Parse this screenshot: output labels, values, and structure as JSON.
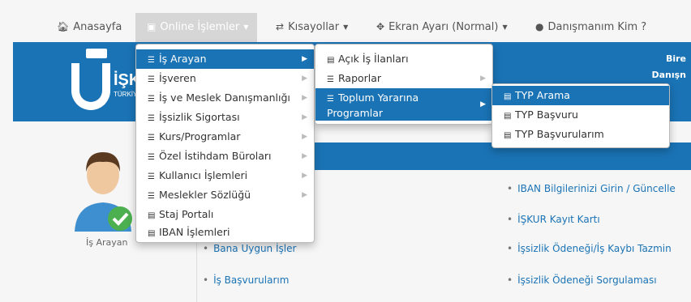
{
  "nav": {
    "home": "Anasayfa",
    "online": "Online İşlemler",
    "shortcuts": "Kısayollar",
    "screen": "Ekran Ayarı (Normal)",
    "advisor": "Danışmanım Kim ?"
  },
  "banner": {
    "logo_text": "İŞK",
    "logo_sub": "TÜRKİYE",
    "right_line1": "Bire",
    "right_line2": "Danışn"
  },
  "profile": {
    "label": "İş Arayan"
  },
  "menu1": [
    {
      "label": "İş Arayan"
    },
    {
      "label": "İşveren"
    },
    {
      "label": "İş ve Meslek Danışmanlığı"
    },
    {
      "label": "İşsizlik Sigortası"
    },
    {
      "label": "Kurs/Programlar"
    },
    {
      "label": "Özel İstihdam Büroları"
    },
    {
      "label": "Kullanıcı İşlemleri"
    },
    {
      "label": "Meslekler Sözlüğü"
    },
    {
      "label": "Staj Portalı"
    },
    {
      "label": "IBAN İşlemleri"
    }
  ],
  "menu2": [
    {
      "label": "Açık İş İlanları"
    },
    {
      "label": "Raporlar"
    },
    {
      "label": "Toplum Yararına"
    },
    {
      "label": "Programlar"
    }
  ],
  "menu3": [
    {
      "label": "TYP Arama"
    },
    {
      "label": "TYP Başvuru"
    },
    {
      "label": "TYP Başvurularım"
    }
  ],
  "links": {
    "left": [
      "Bana Uygun İşler",
      "İş Başvurularım"
    ],
    "right": [
      "IBAN Bilgilerinizi Girin / Güncelle",
      "İŞKUR Kayıt Kartı",
      "İşsizlik Ödeneği/İş Kaybı Tazmin",
      "İşsizlik Ödeneği Sorgulaması"
    ]
  }
}
